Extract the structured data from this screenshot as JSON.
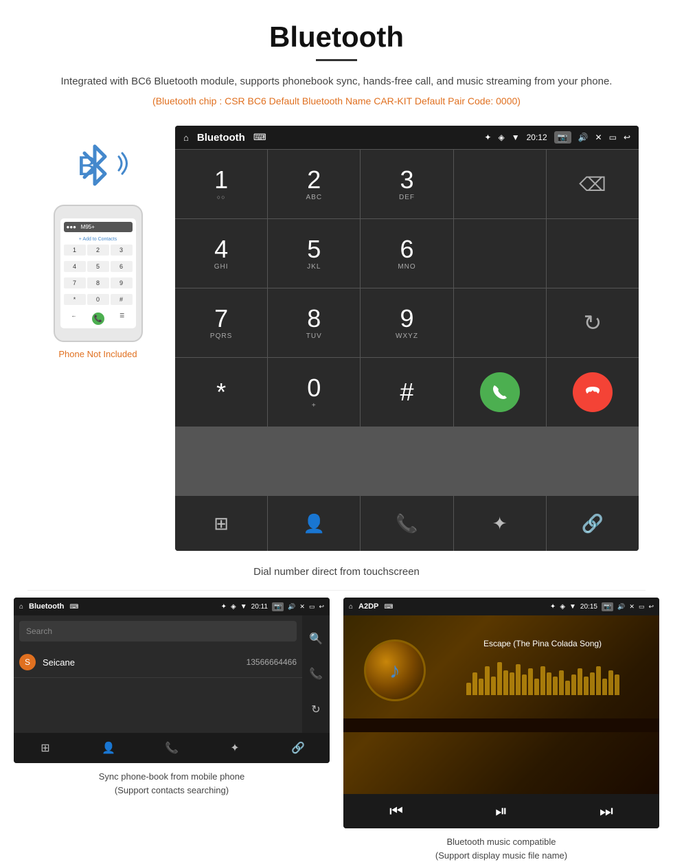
{
  "page": {
    "title": "Bluetooth",
    "subtitle": "Integrated with BC6 Bluetooth module, supports phonebook sync, hands-free call, and music streaming from your phone.",
    "specs": "(Bluetooth chip : CSR BC6    Default Bluetooth Name CAR-KIT    Default Pair Code: 0000)",
    "main_caption": "Dial number direct from touchscreen",
    "phone_not_included": "Phone Not Included"
  },
  "main_screen": {
    "statusbar": {
      "title": "Bluetooth",
      "time": "20:12",
      "usb_icon": "⌨",
      "bt_icon": "✦",
      "location_icon": "◈",
      "signal_icon": "▼"
    },
    "dialpad": {
      "keys": [
        {
          "main": "1",
          "sub": ""
        },
        {
          "main": "2",
          "sub": "ABC"
        },
        {
          "main": "3",
          "sub": "DEF"
        },
        {
          "main": "",
          "sub": ""
        },
        {
          "main": "⌫",
          "sub": "",
          "type": "backspace"
        },
        {
          "main": "4",
          "sub": "GHI"
        },
        {
          "main": "5",
          "sub": "JKL"
        },
        {
          "main": "6",
          "sub": "MNO"
        },
        {
          "main": "",
          "sub": ""
        },
        {
          "main": "",
          "sub": ""
        },
        {
          "main": "7",
          "sub": "PQRS"
        },
        {
          "main": "8",
          "sub": "TUV"
        },
        {
          "main": "9",
          "sub": "WXYZ"
        },
        {
          "main": "",
          "sub": ""
        },
        {
          "main": "↻",
          "sub": "",
          "type": "redial"
        },
        {
          "main": "*",
          "sub": ""
        },
        {
          "main": "0",
          "sub": "+"
        },
        {
          "main": "#",
          "sub": ""
        },
        {
          "main": "📞",
          "sub": "",
          "type": "call-green"
        },
        {
          "main": "📞",
          "sub": "",
          "type": "call-red"
        }
      ],
      "nav_icons": [
        "⊞",
        "👤",
        "📞",
        "✦",
        "🔗"
      ]
    }
  },
  "phonebook_screen": {
    "statusbar_title": "Bluetooth",
    "time": "20:11",
    "search_placeholder": "Search",
    "contact": {
      "letter": "S",
      "name": "Seicane",
      "number": "13566664466"
    },
    "nav_icons": [
      "⊞",
      "👤",
      "📞",
      "✦",
      "🔗"
    ],
    "caption": "Sync phone-book from mobile phone\n(Support contacts searching)"
  },
  "music_screen": {
    "statusbar_title": "A2DP",
    "time": "20:15",
    "song_title": "Escape (The Pina Colada Song)",
    "eq_bars": [
      30,
      55,
      40,
      70,
      45,
      80,
      60,
      55,
      75,
      50,
      65,
      40,
      70,
      55,
      45,
      60,
      35,
      50,
      65,
      45,
      55,
      70,
      40,
      60,
      50
    ],
    "controls": [
      "⏮",
      "⏯",
      "⏭"
    ],
    "caption": "Bluetooth music compatible\n(Support display music file name)"
  }
}
